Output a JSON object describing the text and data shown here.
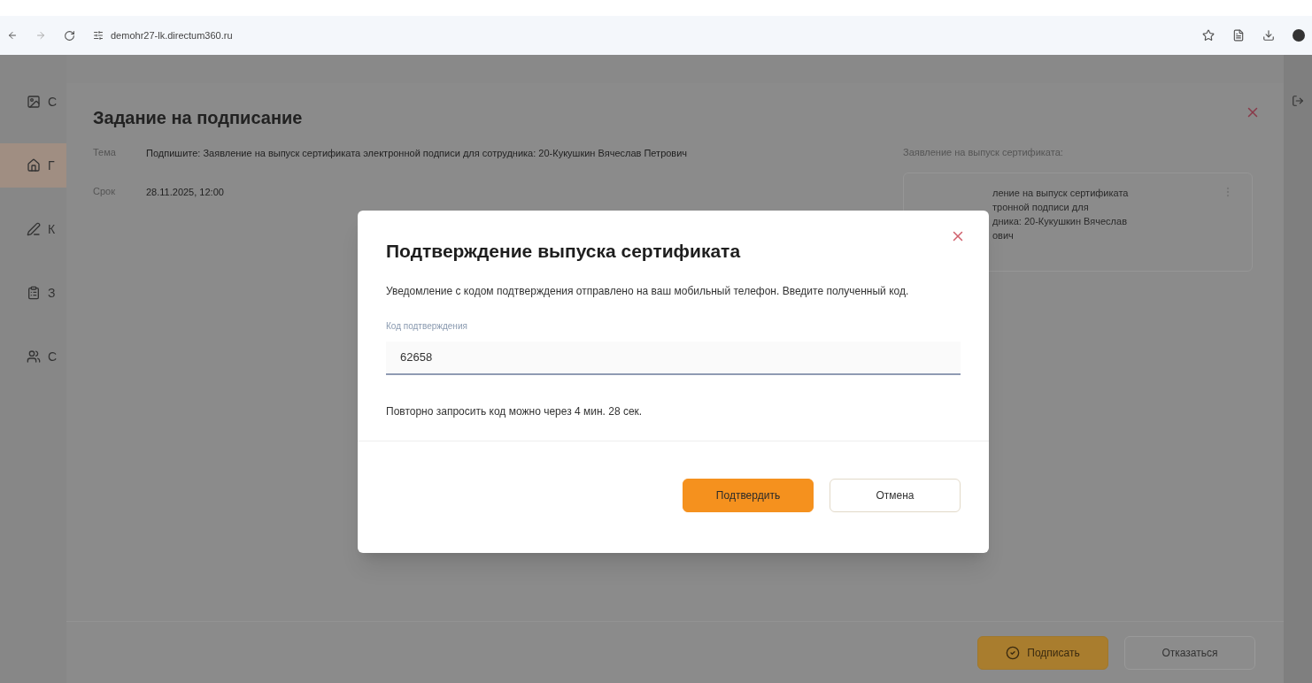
{
  "browser": {
    "url": "demohr27-lk.directum360.ru"
  },
  "sidebar": {
    "items": [
      {
        "label": "С",
        "selected": false
      },
      {
        "label": "Г",
        "selected": true
      },
      {
        "label": "К",
        "selected": false
      },
      {
        "label": "З",
        "selected": false
      },
      {
        "label": "С",
        "selected": false
      }
    ]
  },
  "task": {
    "title": "Задание на подписание",
    "fields": [
      {
        "label": "Тема",
        "value": "Подпишите: Заявление на выпуск сертификата электронной подписи для сотрудника: 20-Кукушкин Вячеслав Петрович"
      },
      {
        "label": "Срок",
        "value": "28.11.2025, 12:00"
      }
    ],
    "attachment_label": "Заявление на выпуск сертификата:",
    "attachment_lines": [
      "ление на выпуск сертификата",
      "тронной подписи для",
      "дника: 20-Кукушкин Вячеслав",
      "ович"
    ],
    "buttons": [
      {
        "kind": "primary",
        "label": "Подписать"
      },
      {
        "kind": "secondary",
        "label": "Отказаться"
      }
    ]
  },
  "dialog": {
    "title": "Подтверждение выпуска сертификата",
    "message": "Уведомление с кодом подтверждения отправлено на ваш мобильный телефон. Введите полученный код.",
    "field": {
      "label": "Код подтверждения",
      "value": "62658"
    },
    "note": "Повторно запросить код можно через 4 мин. 28 сек.",
    "buttons": [
      {
        "kind": "primary",
        "label": "Подтвердить"
      },
      {
        "kind": "secondary",
        "label": "Отмена"
      }
    ]
  }
}
